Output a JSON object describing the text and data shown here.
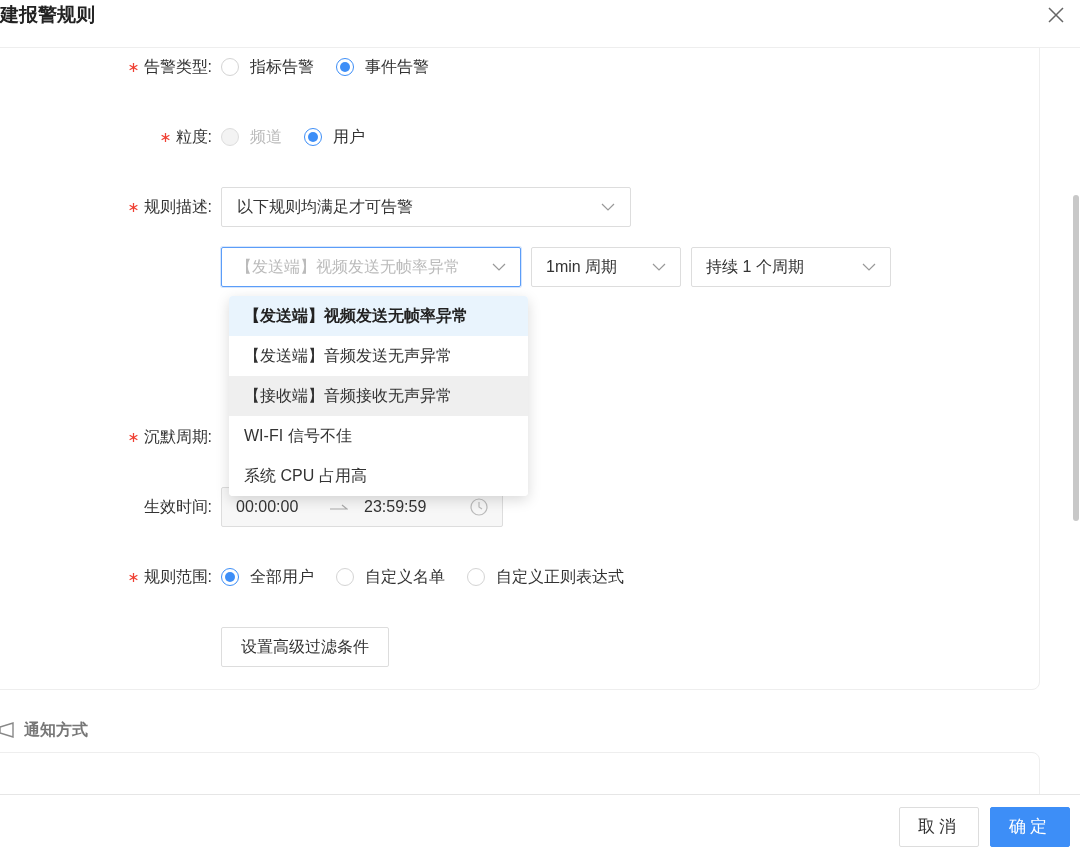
{
  "dialog": {
    "title": "建报警规则"
  },
  "form": {
    "fields": [
      {
        "kind": "radio",
        "label": "告警类型:",
        "required": true,
        "options": [
          {
            "label": "指标告警",
            "selected": false,
            "disabled": false
          },
          {
            "label": "事件告警",
            "selected": true,
            "disabled": false
          }
        ]
      },
      {
        "kind": "radio",
        "label": "粒度:",
        "required": true,
        "options": [
          {
            "label": "频道",
            "selected": false,
            "disabled": true
          },
          {
            "label": "用户",
            "selected": true,
            "disabled": false
          }
        ]
      },
      {
        "kind": "select",
        "label": "规则描述:",
        "required": true,
        "value": "以下规则均满足才可告警"
      },
      {
        "kind": "conditions",
        "selects": [
          {
            "value": "【发送端】视频发送无帧率异常",
            "focused": true
          },
          {
            "value": "1min 周期",
            "focused": false
          },
          {
            "value": "持续 1 个周期",
            "focused": false
          }
        ]
      },
      {
        "kind": "label_only",
        "label": "沉默周期:",
        "required": true
      },
      {
        "kind": "time_range",
        "label": "生效时间:",
        "required": false,
        "start": "00:00:00",
        "end": "23:59:59"
      },
      {
        "kind": "radio",
        "label": "规则范围:",
        "required": true,
        "options": [
          {
            "label": "全部用户",
            "selected": true,
            "disabled": false
          },
          {
            "label": "自定义名单",
            "selected": false,
            "disabled": false
          },
          {
            "label": "自定义正则表达式",
            "selected": false,
            "disabled": false
          }
        ]
      },
      {
        "kind": "button",
        "label": "设置高级过滤条件"
      }
    ]
  },
  "dropdown": {
    "options": [
      {
        "label": "【发送端】视频发送无帧率异常",
        "selected": true,
        "hovered": false
      },
      {
        "label": "【发送端】音频发送无声异常",
        "selected": false,
        "hovered": false
      },
      {
        "label": "【接收端】音频接收无声异常",
        "selected": false,
        "hovered": true
      },
      {
        "label": "WI-FI 信号不佳",
        "selected": false,
        "hovered": false
      },
      {
        "label": "系统 CPU 占用高",
        "selected": false,
        "hovered": false
      }
    ]
  },
  "notify_section": {
    "title": "通知方式"
  },
  "footer_buttons": [
    {
      "label": "取消",
      "kind": "default"
    },
    {
      "label": "确定",
      "kind": "primary"
    }
  ]
}
